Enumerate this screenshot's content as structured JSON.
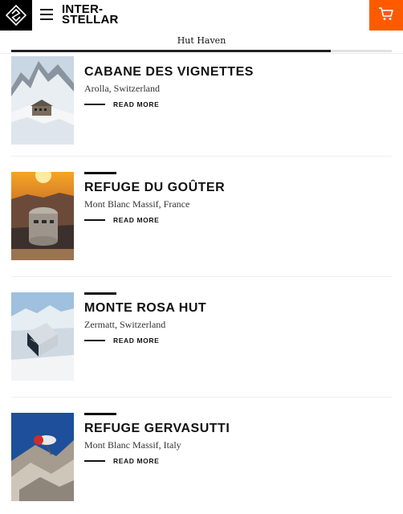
{
  "header": {
    "brand_line1": "INTER-",
    "brand_line2": "STELLAR",
    "logo_icon": "diamond-logo-icon",
    "menu_icon": "hamburger-icon",
    "cart_icon": "cart-icon",
    "cart_color": "#ff5a00"
  },
  "subheader": {
    "title": "Hut Haven",
    "scroll_progress": 0.84
  },
  "huts": [
    {
      "name": "CABANE DES VIGNETTES",
      "location": "Arolla, Switzerland",
      "read_more": "READ MORE"
    },
    {
      "name": "REFUGE DU GOÛTER",
      "location": "Mont Blanc Massif, France",
      "read_more": "READ MORE"
    },
    {
      "name": "MONTE ROSA HUT",
      "location": "Zermatt, Switzerland",
      "read_more": "READ MORE"
    },
    {
      "name": "REFUGE GERVASUTTI",
      "location": "Mont Blanc Massif, Italy",
      "read_more": "READ MORE"
    }
  ]
}
